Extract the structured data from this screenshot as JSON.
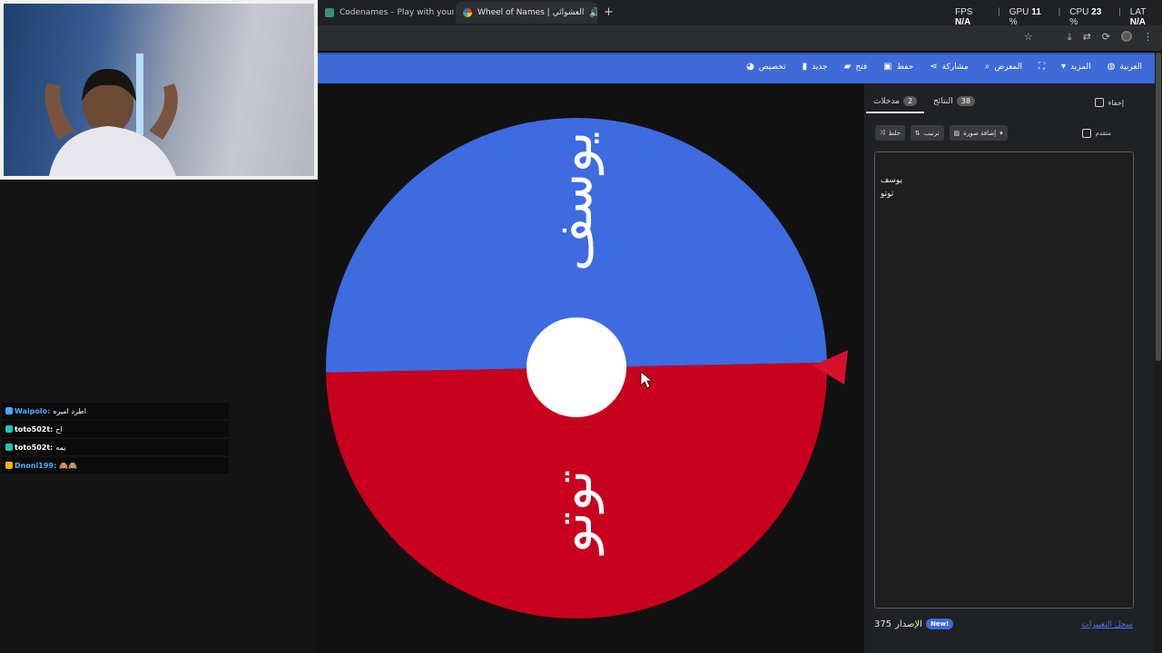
{
  "browser": {
    "tabs": [
      {
        "title": "Codenames – Play with your Fr",
        "active": false
      },
      {
        "title": "Wheel of Names | العشوائي",
        "active": true
      }
    ],
    "perf": {
      "fps_label": "FPS",
      "fps_value": "N/A",
      "gpu_label": "GPU",
      "gpu_value": "11",
      "cpu_label": "CPU",
      "cpu_value": "23",
      "lat_label": "LAT",
      "lat_value": "N/A"
    }
  },
  "toolbar": {
    "items": [
      {
        "label": "العربية",
        "icon": "globe-icon"
      },
      {
        "label": "المزيد",
        "icon": "caret-down-icon"
      },
      {
        "label": "",
        "icon": "fullscreen-icon"
      },
      {
        "label": "المعرض",
        "icon": "search-icon"
      },
      {
        "label": "مشاركة",
        "icon": "share-icon"
      },
      {
        "label": "حفظ",
        "icon": "save-icon"
      },
      {
        "label": "فتح",
        "icon": "folder-icon"
      },
      {
        "label": "جديد",
        "icon": "file-icon"
      },
      {
        "label": "تخصيص",
        "icon": "palette-icon"
      }
    ]
  },
  "wheel": {
    "colors": {
      "top": "#3e6be0",
      "bottom": "#c8001e",
      "pointer": "#d8102e",
      "hub": "#ffffff"
    },
    "segments": [
      {
        "label": "يوسف",
        "color": "#3e6be0"
      },
      {
        "label": "توتو",
        "color": "#c8001e"
      }
    ]
  },
  "panel": {
    "entries_tab": {
      "label": "مدخلات",
      "count": "2"
    },
    "results_tab": {
      "label": "النتائج",
      "count": "38"
    },
    "hide_label": "إخفاء",
    "shuffle_label": "خلط",
    "sort_label": "ترتيب",
    "add_image_label": "إضافة صورة",
    "advanced_label": "متقدم",
    "entries": [
      "يوسف",
      "توتو"
    ],
    "version_label": "الإصدار",
    "version_number": "375",
    "new_badge": "New!",
    "changelog_label": "سجل التغييرات"
  },
  "chat": [
    {
      "user": "Waipolo:",
      "message": "اطرد اميره",
      "user_color": "#4aa8ff"
    },
    {
      "user": "toto502t:",
      "message": "اح",
      "user_color": "#ffffff"
    },
    {
      "user": "toto502t:",
      "message": "يمه",
      "user_color": "#ffffff"
    },
    {
      "user": "Dnoni199:",
      "message": "🙈🙈",
      "user_color": "#4ab0ff"
    }
  ]
}
